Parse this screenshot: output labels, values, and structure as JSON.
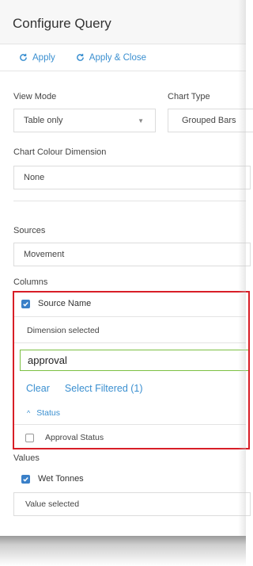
{
  "header": {
    "title": "Configure Query"
  },
  "actions": {
    "apply": "Apply",
    "apply_close": "Apply & Close"
  },
  "view_mode": {
    "label": "View Mode",
    "value": "Table only"
  },
  "chart_type": {
    "label": "Chart Type",
    "value": "Grouped Bars"
  },
  "colour_dimension": {
    "label": "Chart Colour Dimension",
    "value": "None"
  },
  "sources": {
    "label": "Sources",
    "value": "Movement"
  },
  "columns": {
    "label": "Columns",
    "item": "Source Name",
    "item_checked": true,
    "status_text": "Dimension selected",
    "search_value": "approval",
    "clear": "Clear",
    "select_filtered": "Select Filtered (1)",
    "group": "Status",
    "group_item": "Approval Status",
    "group_item_checked": false
  },
  "values": {
    "label": "Values",
    "item": "Wet Tonnes",
    "item_checked": true,
    "status_text": "Value selected"
  },
  "colors": {
    "accent": "#3a8fd0",
    "highlight_border": "#d81e27",
    "search_border": "#7cc043"
  }
}
